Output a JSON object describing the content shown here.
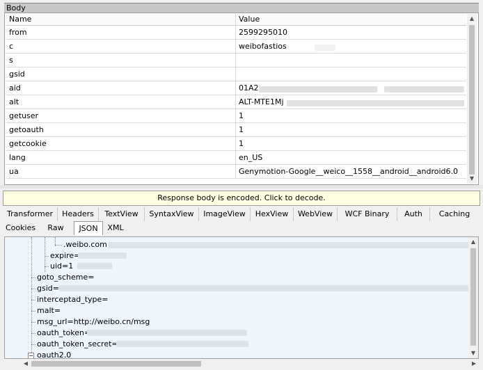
{
  "section_title": "Body",
  "grid": {
    "headers": [
      "Name",
      "Value"
    ],
    "rows": [
      {
        "name": "from",
        "value": "2599295010"
      },
      {
        "name": "c",
        "value": "weibofastios"
      },
      {
        "name": "s",
        "value": ""
      },
      {
        "name": "gsid",
        "value": ""
      },
      {
        "name": "aid",
        "value": "01A2"
      },
      {
        "name": "alt",
        "value": "ALT-MTE1Mj"
      },
      {
        "name": "getuser",
        "value": "1"
      },
      {
        "name": "getoauth",
        "value": "1"
      },
      {
        "name": "getcookie",
        "value": "1"
      },
      {
        "name": "lang",
        "value": "en_US"
      },
      {
        "name": "ua",
        "value": "Genymotion-Google__weico__1558__android__android6.0"
      }
    ]
  },
  "notice": "Response body is encoded. Click to decode.",
  "tabs_row1": [
    "Transformer",
    "Headers",
    "TextView",
    "SyntaxView",
    "ImageView",
    "HexView",
    "WebView",
    "WCF Binary",
    "Auth",
    "Caching"
  ],
  "tabs_row2": [
    "Cookies",
    "Raw",
    "JSON",
    "XML"
  ],
  "active_tab": "JSON",
  "tree": {
    "weibo_domain": ".weibo.com=",
    "expire": "expire=",
    "uid": "uid=1",
    "goto_scheme": "goto_scheme=",
    "gsid": "gsid=",
    "interceptad_type": "interceptad_type=",
    "malt": "malt=",
    "msg_url": "msg_url=http://weibo.cn/msg",
    "oauth_token": "oauth_token=",
    "oauth_token_secret": "oauth_token_secret=",
    "oauth2": "oauth2.0"
  },
  "icons": {
    "scroll_up": "scroll-up-icon",
    "scroll_down": "scroll-down-icon",
    "scroll_left": "scroll-left-icon",
    "scroll_right": "scroll-right-icon",
    "tree_expander": "tree-expander-icon"
  }
}
